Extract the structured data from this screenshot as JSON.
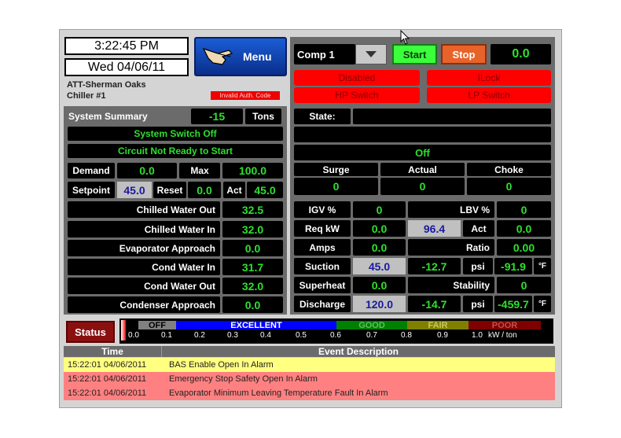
{
  "clock": {
    "time": "3:22:45 PM",
    "date": "Wed 04/06/11"
  },
  "menu": {
    "label": "Menu"
  },
  "site": {
    "name": "ATT-Sherman Oaks",
    "unit": "Chiller #1",
    "auth_warning": "Invalid Auth. Code"
  },
  "summary": {
    "title": "System Summary",
    "value": "-15",
    "unit": "Tons",
    "status1": "System Switch Off",
    "status2": "Circuit Not Ready to Start",
    "demand_label": "Demand",
    "demand": "0.0",
    "max_label": "Max",
    "max": "100.0",
    "setpoint_label": "Setpoint",
    "setpoint": "45.0",
    "reset_label": "Reset",
    "reset": "0.0",
    "act_label": "Act",
    "act": "45.0",
    "rows": [
      {
        "label": "Chilled Water Out",
        "value": "32.5"
      },
      {
        "label": "Chilled Water In",
        "value": "32.0"
      },
      {
        "label": "Evaporator Approach",
        "value": "0.0"
      },
      {
        "label": "Cond Water In",
        "value": "31.7"
      },
      {
        "label": "Cond Water Out",
        "value": "32.0"
      },
      {
        "label": "Condenser Approach",
        "value": "0.0"
      }
    ]
  },
  "comp": {
    "select": "Comp 1",
    "start": "Start",
    "stop": "Stop",
    "value": "0.0",
    "alarms": [
      "Disabled",
      "ILock",
      "HP Switch",
      "LP Switch"
    ],
    "state_label": "State:",
    "state": "",
    "state2": "",
    "mode": "Off",
    "surge_label": "Surge",
    "actual_label": "Actual",
    "choke_label": "Choke",
    "surge": "0",
    "actual": "0",
    "choke": "0",
    "igv_label": "IGV %",
    "igv": "0",
    "lbv_label": "LBV %",
    "lbv": "0",
    "reqkw_label": "Req kW",
    "reqkw": "0.0",
    "reqkw_mid": "96.4",
    "act_label": "Act",
    "act": "0.0",
    "amps_label": "Amps",
    "amps": "0.0",
    "ratio_label": "Ratio",
    "ratio": "0.00",
    "suction_label": "Suction",
    "suction": "45.0",
    "suction_p": "-12.7",
    "psi": "psi",
    "suction_t": "-91.9",
    "degf": "°F",
    "superheat_label": "Superheat",
    "superheat": "0.0",
    "stability_label": "Stability",
    "stability": "0",
    "discharge_label": "Discharge",
    "discharge": "120.0",
    "discharge_p": "-14.7",
    "discharge_t": "-459.7"
  },
  "status": {
    "label": "Status",
    "bands": [
      {
        "label": "OFF",
        "color": "#808080"
      },
      {
        "label": "EXCELLENT",
        "color": "#0000ff"
      },
      {
        "label": "GOOD",
        "color": "#008000"
      },
      {
        "label": "FAIR",
        "color": "#808000"
      },
      {
        "label": "POOR",
        "color": "#800000"
      }
    ],
    "ticks": [
      "0.0",
      "0.1",
      "0.2",
      "0.3",
      "0.4",
      "0.5",
      "0.6",
      "0.7",
      "0.8",
      "0.9",
      "1.0"
    ],
    "unit": "kW / ton",
    "level": 0.0
  },
  "events": {
    "col_time": "Time",
    "col_desc": "Event Description",
    "rows": [
      {
        "time": "15:22:01 04/06/2011",
        "desc": "BAS Enable Open In Alarm",
        "color": "#ffff80"
      },
      {
        "time": "15:22:01 04/06/2011",
        "desc": "Emergency Stop Safety Open In Alarm",
        "color": "#ff8080"
      },
      {
        "time": "15:22:01 04/06/2011",
        "desc": "Evaporator Minimum Leaving Temperature Fault In Alarm",
        "color": "#ff8080"
      }
    ]
  }
}
